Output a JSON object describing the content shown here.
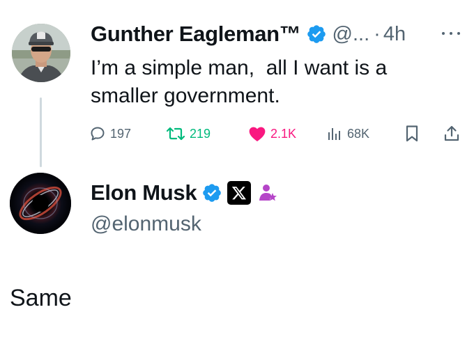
{
  "parent_tweet": {
    "author_name": "Gunther Eagleman™",
    "handle": "@...",
    "separator": "·",
    "time": "4h",
    "text": "I’m a simple man,  all I want is a smaller government.",
    "avatar_icon": "profile-photo",
    "verified_icon": "verified-badge-icon",
    "more_icon": "more-icon",
    "actions": {
      "replies": "197",
      "reposts": "219",
      "likes": "2.1K",
      "views": "68K"
    }
  },
  "reply_tweet": {
    "author_name": "Elon Musk",
    "handle": "@elonmusk",
    "text": "Same",
    "avatar_icon": "blackhole-avatar",
    "badges": [
      "verified-badge-icon",
      "x-affiliation-icon",
      "space-host-icon"
    ]
  },
  "colors": {
    "text": "#0f1419",
    "secondary": "#536471",
    "verified": "#1d9bf0",
    "repost": "#00ba7c",
    "like": "#f91880",
    "thread_line": "#cfd9de",
    "space_badge": "#b545c8"
  }
}
